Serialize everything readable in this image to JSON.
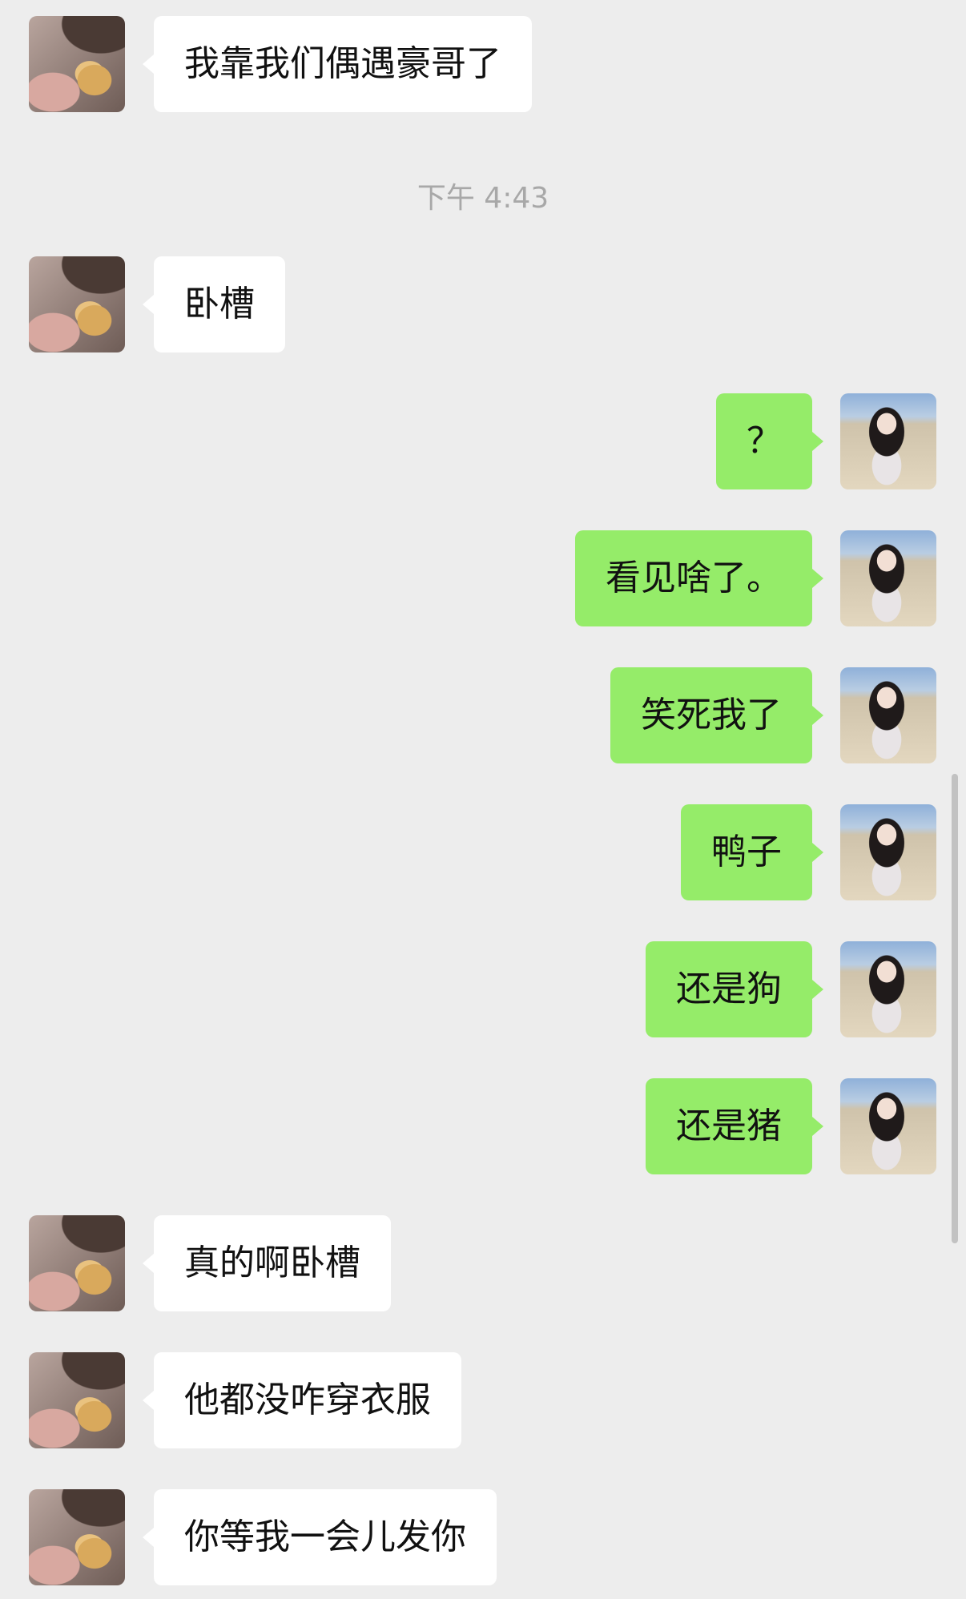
{
  "timestamp": "下午 4:43",
  "messages": [
    {
      "side": "in",
      "text": "我靠我们偶遇豪哥了"
    },
    {
      "side": "in",
      "text": "卧槽"
    },
    {
      "side": "out",
      "text": "？"
    },
    {
      "side": "out",
      "text": "看见啥了。"
    },
    {
      "side": "out",
      "text": "笑死我了"
    },
    {
      "side": "out",
      "text": "鸭子"
    },
    {
      "side": "out",
      "text": "还是狗"
    },
    {
      "side": "out",
      "text": "还是猪"
    },
    {
      "side": "in",
      "text": "真的啊卧槽"
    },
    {
      "side": "in",
      "text": "他都没咋穿衣服"
    },
    {
      "side": "in",
      "text": "你等我一会儿发你"
    }
  ],
  "colors": {
    "background": "#ededed",
    "incoming_bubble": "#ffffff",
    "outgoing_bubble": "#95ec69",
    "timestamp_text": "#a8a8a8"
  },
  "icons": {
    "friend_avatar": "avatar-photo-girl-with-bear-cookie",
    "self_avatar": "avatar-photo-girl-on-beach"
  }
}
